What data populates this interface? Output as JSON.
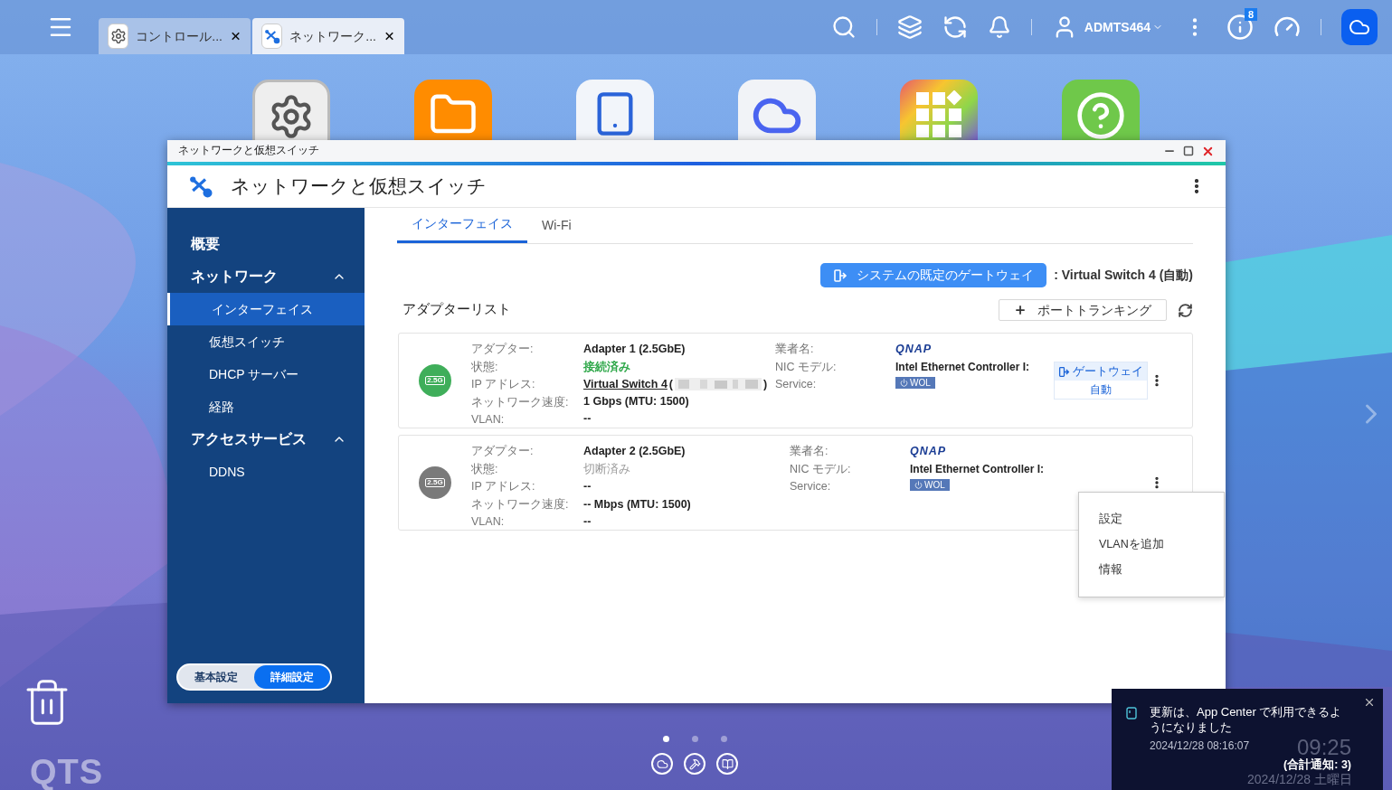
{
  "taskbar": {
    "tabs": [
      {
        "label": "コントロール...",
        "selected": false,
        "kind": "gear"
      },
      {
        "label": "ネットワーク...",
        "selected": true,
        "kind": "network"
      }
    ],
    "user": "ADMTS464",
    "info_badge": "8"
  },
  "window": {
    "title": "ネットワークと仮想スイッチ",
    "header": "ネットワークと仮想スイッチ"
  },
  "sidebar": {
    "items": [
      {
        "label": "概要",
        "kind": "top"
      },
      {
        "label": "ネットワーク",
        "kind": "group",
        "expanded": true,
        "children": [
          {
            "label": "インターフェイス",
            "selected": true
          },
          {
            "label": "仮想スイッチ",
            "selected": false
          },
          {
            "label": "DHCP サーバー",
            "selected": false
          },
          {
            "label": "経路",
            "selected": false
          }
        ]
      },
      {
        "label": "アクセスサービス",
        "kind": "group",
        "expanded": true,
        "children": [
          {
            "label": "DDNS",
            "selected": false
          }
        ]
      }
    ],
    "mode_toggle": [
      {
        "label": "基本設定",
        "selected": false
      },
      {
        "label": "詳細設定",
        "selected": true
      }
    ]
  },
  "tabs": [
    {
      "label": "インターフェイス",
      "selected": true
    },
    {
      "label": "Wi-Fi",
      "selected": false
    }
  ],
  "gateway": {
    "button": "システムの既定のゲートウェイ",
    "value": ": Virtual Switch 4 (自動)"
  },
  "adapter_list": {
    "title": "アダプターリスト",
    "trunk_button": "ポートトランキング"
  },
  "adapters": [
    {
      "connected": true,
      "badge": "2.5G",
      "fields": [
        {
          "label": "アダプター:",
          "value": "Adapter 1 (2.5GbE)",
          "kind": "plain"
        },
        {
          "label": "状態:",
          "value": "接続済み",
          "kind": "status"
        },
        {
          "label": "IP アドレス:",
          "value": "Virtual Switch 4",
          "kind": "link",
          "open": "(",
          "close": ")"
        },
        {
          "label": "ネットワーク速度:",
          "value": "1 Gbps (MTU: 1500)",
          "kind": "plain"
        },
        {
          "label": "VLAN:",
          "value": "--",
          "kind": "plain"
        }
      ],
      "vendor": {
        "label": "業者名:",
        "logo": "QNAP"
      },
      "nic": {
        "label": "NIC モデル:",
        "value": "Intel Ethernet Controller I:"
      },
      "service": {
        "label": "Service:",
        "value": "WOL"
      },
      "gateway_tag": {
        "label": "ゲートウェイ",
        "mode": "自動"
      }
    },
    {
      "connected": false,
      "badge": "2.5G",
      "fields": [
        {
          "label": "アダプター:",
          "value": "Adapter 2 (2.5GbE)",
          "kind": "plain"
        },
        {
          "label": "状態:",
          "value": "切断済み",
          "kind": "status"
        },
        {
          "label": "IP アドレス:",
          "value": "--",
          "kind": "plain"
        },
        {
          "label": "ネットワーク速度:",
          "value": "-- Mbps (MTU: 1500)",
          "kind": "plain"
        },
        {
          "label": "VLAN:",
          "value": "--",
          "kind": "plain"
        }
      ],
      "vendor": {
        "label": "業者名:",
        "logo": "QNAP"
      },
      "nic": {
        "label": "NIC モデル:",
        "value": "Intel Ethernet Controller I:"
      },
      "service": {
        "label": "Service:",
        "value": "WOL"
      }
    }
  ],
  "context_menu": {
    "items": [
      "設定",
      "VLANを追加",
      "情報"
    ]
  },
  "clock": {
    "time": "09:25",
    "date": "2024/12/28 土曜日"
  },
  "notification": {
    "message": "更新は、App Center で利用できるようになりました",
    "time": "2024/12/28 08:16:07",
    "total": "(合計通知: 3)"
  },
  "dock": {
    "pages": [
      {
        "selected": true
      },
      {
        "selected": false
      },
      {
        "selected": false
      }
    ]
  },
  "brand": "QTS"
}
